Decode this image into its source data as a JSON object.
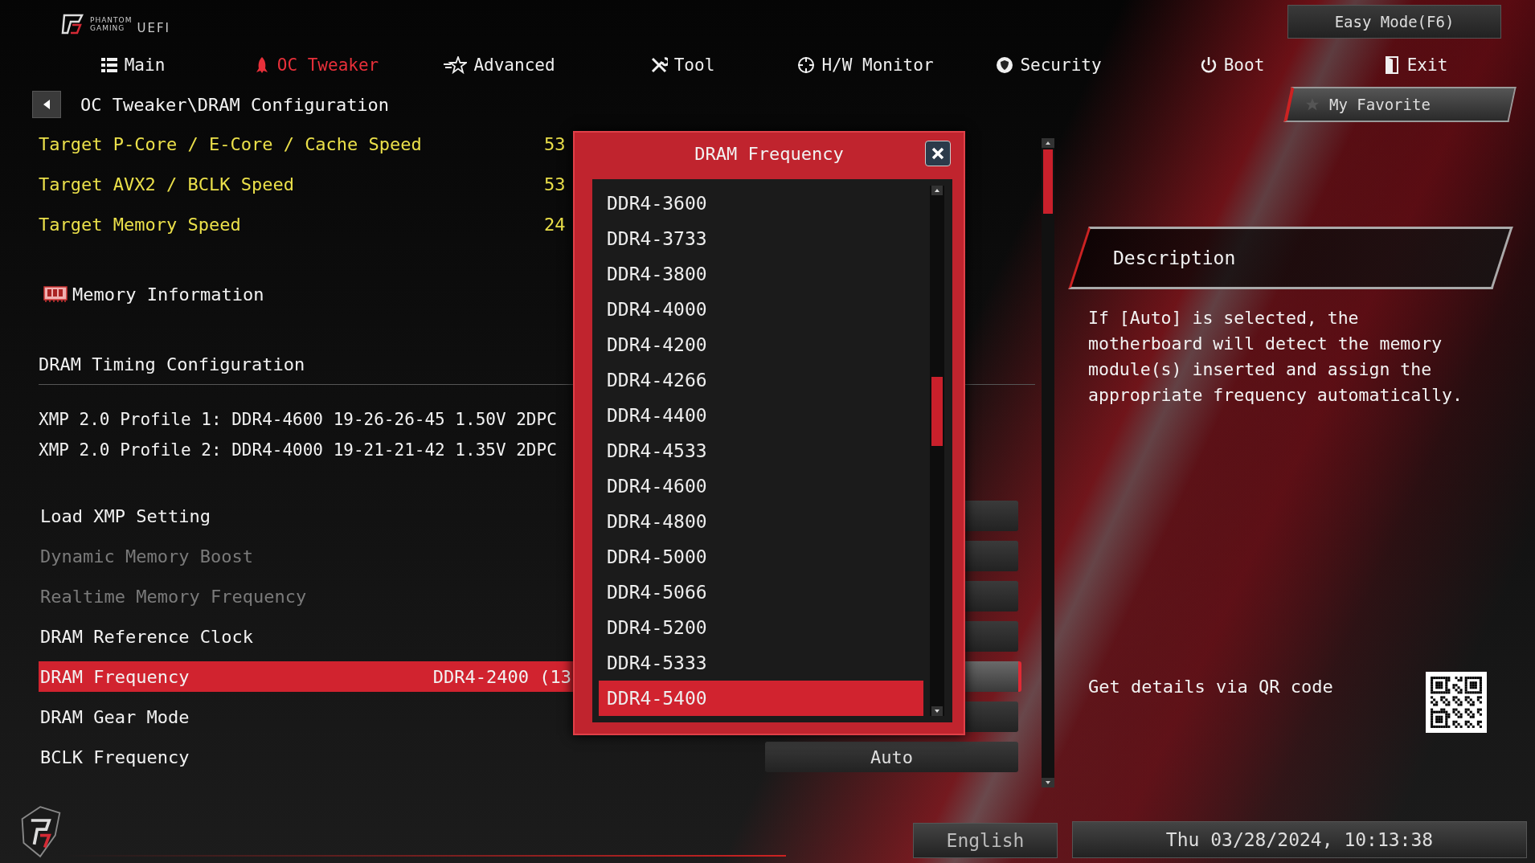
{
  "brand": {
    "name_lines": [
      "PHANTOM",
      "GAMING"
    ],
    "suffix": "UEFI"
  },
  "easy_mode_button": "Easy Mode(F6)",
  "tabs": [
    {
      "label": "Main",
      "selected": false
    },
    {
      "label": "OC Tweaker",
      "selected": true
    },
    {
      "label": "Advanced",
      "selected": false
    },
    {
      "label": "Tool",
      "selected": false
    },
    {
      "label": "H/W Monitor",
      "selected": false
    },
    {
      "label": "Security",
      "selected": false
    },
    {
      "label": "Boot",
      "selected": false
    },
    {
      "label": "Exit",
      "selected": false
    }
  ],
  "breadcrumb": "OC Tweaker\\DRAM Configuration",
  "favorite_button": "My Favorite",
  "settings": [
    {
      "kind": "target",
      "label": "Target P-Core / E-Core / Cache Speed",
      "value": "53"
    },
    {
      "kind": "target",
      "label": "Target AVX2 / BCLK Speed",
      "value": "53"
    },
    {
      "kind": "target",
      "label": "Target Memory Speed",
      "value": "24"
    },
    {
      "kind": "submenu",
      "label": "Memory Information"
    },
    {
      "kind": "section",
      "label": "DRAM Timing Configuration"
    },
    {
      "kind": "profile",
      "label": "XMP 2.0 Profile 1: DDR4-4600 19-26-26-45 1.50V 2DPC"
    },
    {
      "kind": "profile",
      "label": "XMP 2.0 Profile 2: DDR4-4000 19-21-21-42 1.35V 2DPC"
    },
    {
      "kind": "option",
      "label": "Load XMP Setting",
      "disabled": false,
      "selected": false
    },
    {
      "kind": "option",
      "label": "Dynamic Memory Boost",
      "disabled": true,
      "selected": false
    },
    {
      "kind": "option",
      "label": "Realtime Memory Frequency",
      "disabled": true,
      "selected": false
    },
    {
      "kind": "option",
      "label": "DRAM Reference Clock",
      "disabled": false,
      "selected": false
    },
    {
      "kind": "option",
      "label": "DRAM Frequency",
      "disabled": false,
      "selected": true,
      "current": "DDR4-2400 (13"
    },
    {
      "kind": "option",
      "label": "DRAM Gear Mode",
      "disabled": false,
      "selected": false
    },
    {
      "kind": "option",
      "label": "BCLK Frequency",
      "disabled": false,
      "selected": false,
      "value": "Auto"
    }
  ],
  "dialog": {
    "title": "DRAM Frequency",
    "options": [
      {
        "label": "DDR4-3600",
        "selected": false
      },
      {
        "label": "DDR4-3733",
        "selected": false
      },
      {
        "label": "DDR4-3800",
        "selected": false
      },
      {
        "label": "DDR4-4000",
        "selected": false
      },
      {
        "label": "DDR4-4200",
        "selected": false
      },
      {
        "label": "DDR4-4266",
        "selected": false
      },
      {
        "label": "DDR4-4400",
        "selected": false
      },
      {
        "label": "DDR4-4533",
        "selected": false
      },
      {
        "label": "DDR4-4600",
        "selected": false
      },
      {
        "label": "DDR4-4800",
        "selected": false
      },
      {
        "label": "DDR4-5000",
        "selected": false
      },
      {
        "label": "DDR4-5066",
        "selected": false
      },
      {
        "label": "DDR4-5200",
        "selected": false
      },
      {
        "label": "DDR4-5333",
        "selected": false
      },
      {
        "label": "DDR4-5400",
        "selected": true
      }
    ]
  },
  "description": {
    "title": "Description",
    "text": "If [Auto] is selected, the motherboard will detect the memory module(s) inserted and assign the appropriate frequency automatically."
  },
  "qr_hint": "Get details via QR code",
  "status_bar": {
    "language": "English",
    "datetime": "Thu 03/28/2024, 10:13:38"
  }
}
